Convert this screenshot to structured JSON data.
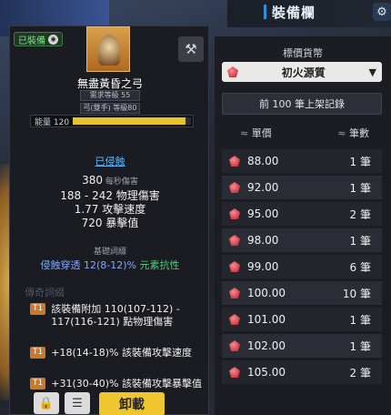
{
  "header": {
    "title": "裝備欄",
    "gear_icon": "gear-icon"
  },
  "item": {
    "equipped_badge": "已裝備",
    "badge_icon": "lock-icon",
    "name": "無盡黃昏之弓",
    "req_level": "需求等級 55",
    "weapon_type": "弓(雙手)",
    "req_level_value": "等級80",
    "energy_label": "能量 120",
    "energy_fill": 0.95,
    "corrode": "已侵蝕",
    "stats": [
      {
        "value": "380",
        "suffix": " 每秒傷害"
      },
      {
        "value": "188 - 242 物理傷害"
      },
      {
        "value": "1.77 攻擊速度"
      },
      {
        "value": "720 暴擊值"
      }
    ],
    "base_section": "基礎詞綴",
    "base_attr_main": "侵蝕穿透 12(8-12)% ",
    "base_attr_green": "元素抗性",
    "affix_section": "傳奇詞綴",
    "affixes": [
      {
        "tier": "T1",
        "text": "該裝備附加 110(107-112) - 117(116-121) 點物理傷害"
      },
      {
        "tier": "T1",
        "text": "+18(14-18)% 該裝備攻擊速度"
      },
      {
        "tier": "T1",
        "text": "+31(30-40)% 該裝備攻擊暴擊值"
      }
    ],
    "buttons": {
      "lock": "🔒",
      "menu": "☰",
      "unload": "卸載"
    }
  },
  "market": {
    "label": "標價貨幣",
    "currency": "初火源質",
    "records": "前 100 筆上架記錄",
    "col_price": "單價",
    "col_qty": "筆數",
    "rows": [
      {
        "price": "88.00",
        "qty": "1 筆"
      },
      {
        "price": "92.00",
        "qty": "1 筆"
      },
      {
        "price": "95.00",
        "qty": "2 筆"
      },
      {
        "price": "98.00",
        "qty": "1 筆"
      },
      {
        "price": "99.00",
        "qty": "6 筆"
      },
      {
        "price": "100.00",
        "qty": "10 筆"
      },
      {
        "price": "101.00",
        "qty": "1 筆"
      },
      {
        "price": "102.00",
        "qty": "1 筆"
      },
      {
        "price": "105.00",
        "qty": "2 筆"
      }
    ]
  },
  "colors": {
    "accent": "#f0c630",
    "blue_link": "#5fb7ff",
    "tier": "#c77a2a",
    "gem": "#b5182c"
  }
}
